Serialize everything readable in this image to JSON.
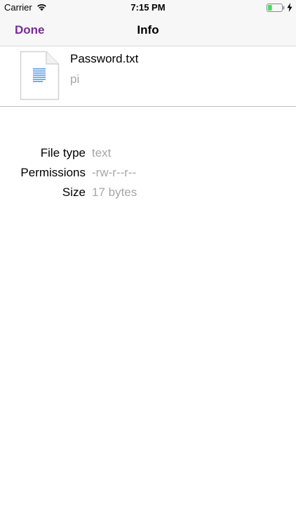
{
  "status_bar": {
    "carrier": "Carrier",
    "time": "7:15 PM",
    "wifi_icon": "wifi-icon",
    "battery_icon": "battery-icon",
    "battery_level": 0.3,
    "charging_icon": "charging-bolt-icon"
  },
  "nav": {
    "done_label": "Done",
    "title": "Info",
    "accent_color": "#7b2a9b"
  },
  "file": {
    "icon": "text-document-icon",
    "name": "Password.txt",
    "subtitle": "pi"
  },
  "info": [
    {
      "label": "File type",
      "value": "text"
    },
    {
      "label": "Permissions",
      "value": "-rw-r--r--"
    },
    {
      "label": "Size",
      "value": "17 bytes"
    }
  ]
}
